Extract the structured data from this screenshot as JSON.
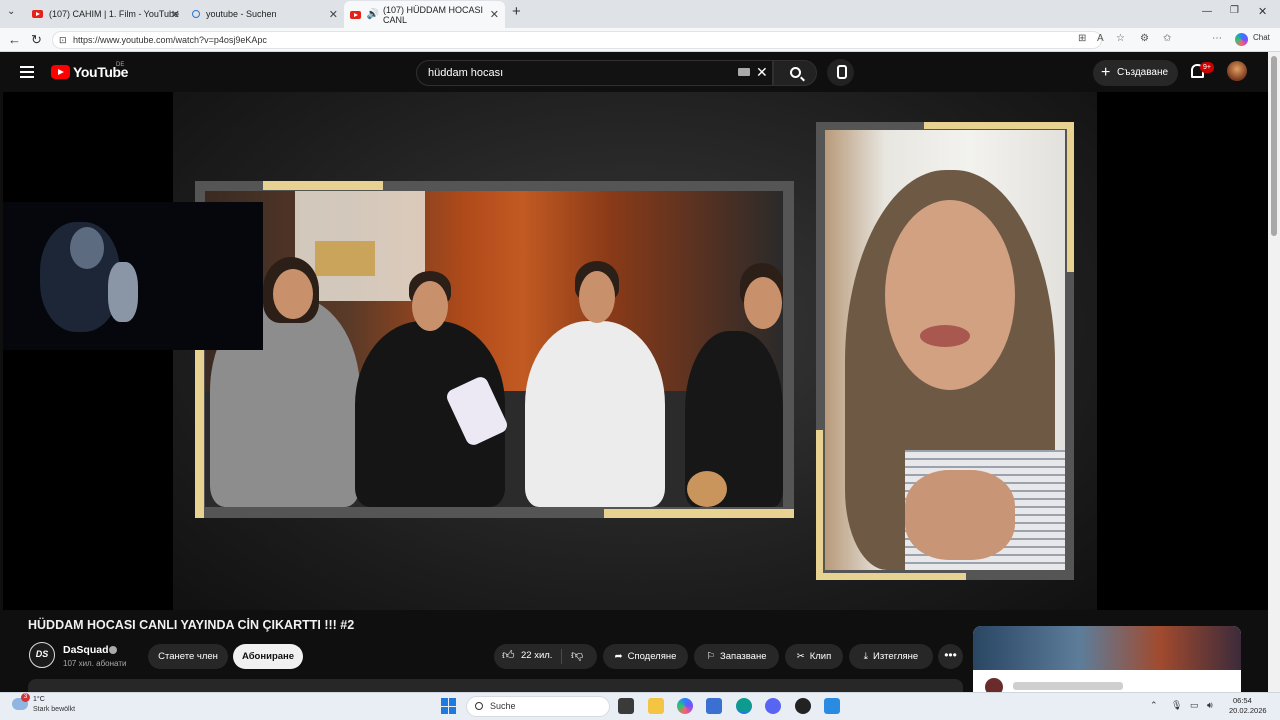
{
  "browser": {
    "tabs": [
      {
        "title": "(107) CAHIM | 1. Film - YouTube",
        "icon": "youtube-icon"
      },
      {
        "title": "youtube - Suchen",
        "icon": "search-icon"
      },
      {
        "title": "(107) HÜDDAM HOCASI CANL",
        "icon": "youtube-icon",
        "audio": true,
        "active": true
      }
    ],
    "new_tab": "+",
    "url": "https://www.youtube.com/watch?v=p4osj9eKApc",
    "chat_label": "Chat"
  },
  "youtube": {
    "logo_text": "YouTube",
    "country_code": "DE",
    "search_value": "hüddam hocası",
    "create_label": "Създаване",
    "notification_count": "9+",
    "video": {
      "title": "HÜDDAM HOCASI CANLI YAYINDA CİN ÇIKARTTI !!! #2",
      "channel": "DaSquad",
      "channel_avatar_text": "DS",
      "subscribers": "107 хил. абонати",
      "join_label": "Станете член",
      "subscribe_label": "Абониране",
      "likes": "22 хил.",
      "share_label": "Споделяне",
      "save_label": "Запазване",
      "clip_label": "Клип",
      "download_label": "Изтегляне",
      "more_label": "•••"
    }
  },
  "taskbar": {
    "weather_temp": "1°C",
    "weather_desc": "Stark bewölkt",
    "weather_badge": "3",
    "search_placeholder": "Suche",
    "time": "06:54",
    "date": "20.02.2026"
  },
  "colors": {
    "yt_red": "#ff0000",
    "frame_gold": "#e8d291",
    "background": "#0f0f0f"
  }
}
